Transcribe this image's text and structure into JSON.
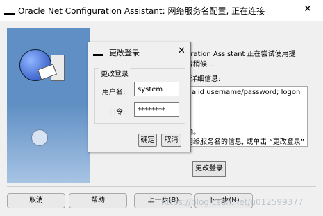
{
  "window": {
    "title": "Oracle Net Configuration Assistant: 网络服务名配置, 正在连接",
    "close_glyph": "✕"
  },
  "body": {
    "line1": "uration Assistant 正在尝试使用提",
    "line2": "青稍候...",
    "details_label": "详细信息:",
    "details_line1": "alid username/password; logon",
    "line_ok": "确。",
    "line_instruction": "网络服务名的信息, 或单击 “更改登录”",
    "change_login_button": "更改登录"
  },
  "footer": {
    "cancel": "取消",
    "help": "帮助",
    "prev": "上一步(B)",
    "next": "下一步(N)"
  },
  "dialog": {
    "title": "更改登录",
    "close_glyph": "✕",
    "group_label": "更改登录",
    "username_label": "用户名:",
    "username_value": "system",
    "password_label": "口令:",
    "password_value": "********",
    "ok": "确定",
    "cancel": "取消"
  },
  "watermark": "https://blog.csdn.net/u012599377",
  "colors": {
    "illustration_blue": "#5f8fc4",
    "watermark": "#aab4bd"
  }
}
